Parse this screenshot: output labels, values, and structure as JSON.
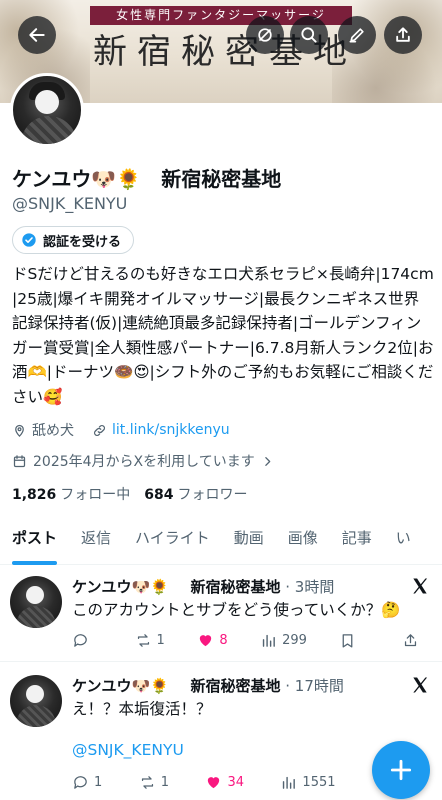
{
  "banner": {
    "strip_text": "女性専門ファンタジーマッサージ",
    "title": "新宿秘密基地"
  },
  "profile": {
    "name": "ケンユウ🐶🌻　新宿秘密基地",
    "handle": "@SNJK_KENYU",
    "verify_label": "認証を受ける",
    "bio": "ドSだけど甘えるのも好きなエロ犬系セラピ×長崎弁|174cm|25歳|爆イキ開発オイルマッサージ|最長クンニギネス世界記録保持者(仮)|連続絶頂最多記録保持者|ゴールデンフィンガー賞受賞|全人類性感パートナー|6.7.8月新人ランク2位|お酒🫶|ドーナツ🍩😍|シフト外のご予約もお気軽にご相談ください🥰",
    "location": "舐め犬",
    "link": "lit.link/snjkkenyu",
    "joined": "2025年4月からXを利用しています",
    "following_count": "1,826",
    "following_label": "フォロー中",
    "followers_count": "684",
    "followers_label": "フォロワー"
  },
  "tabs": [
    "ポスト",
    "返信",
    "ハイライト",
    "動画",
    "画像",
    "記事",
    "い"
  ],
  "posts": [
    {
      "name": "ケンユウ🐶🌻",
      "org": "新宿秘密基地",
      "time": "· 3時間",
      "text": "このアカウントとサブをどう使っていくか？🤔",
      "mention": "",
      "replies": "",
      "reposts": "1",
      "likes": "8",
      "views": "299"
    },
    {
      "name": "ケンユウ🐶🌻",
      "org": "新宿秘密基地",
      "time": "· 17時間",
      "text": "え！？本垢復活！？",
      "mention": "@SNJK_KENYU",
      "replies": "1",
      "reposts": "1",
      "likes": "34",
      "views": "1551"
    }
  ],
  "colors": {
    "accent": "#1d9bf0",
    "like": "#f91880",
    "muted": "#536471"
  }
}
